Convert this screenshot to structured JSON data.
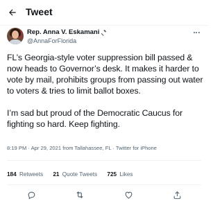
{
  "header": {
    "title": "Tweet"
  },
  "author": {
    "name": "Rep. Anna V. Eskamani",
    "handle": "@AnnaForFlorida"
  },
  "tweet": {
    "paragraphs": [
      "FL’s Georgia-style voter suppression bill passed & now heads to Governor’s desk. It makes it harder to vote by mail, prohibits groups from passing out water to voters & tries to limit ballot boxes.",
      "I’m sad but proud of the Democratic Caucus for fighting so hard. Keep fighting."
    ],
    "meta": "8:19 PM · Apr 29, 2021 from Tallahassee, FL · Twitter for iPhone"
  },
  "stats": {
    "retweets": {
      "count": "184",
      "label": "Retweets"
    },
    "quotes": {
      "count": "21",
      "label": "Quote Tweets"
    },
    "likes": {
      "count": "725",
      "label": "Likes"
    }
  },
  "colors": {
    "text": "#0f1419",
    "secondary": "#536471",
    "divider": "#eff3f4",
    "accent": "#1d9bf0"
  },
  "icons": [
    "back-arrow-icon",
    "gavel-icon",
    "more-icon",
    "reply-icon",
    "retweet-icon",
    "like-icon",
    "share-icon"
  ]
}
